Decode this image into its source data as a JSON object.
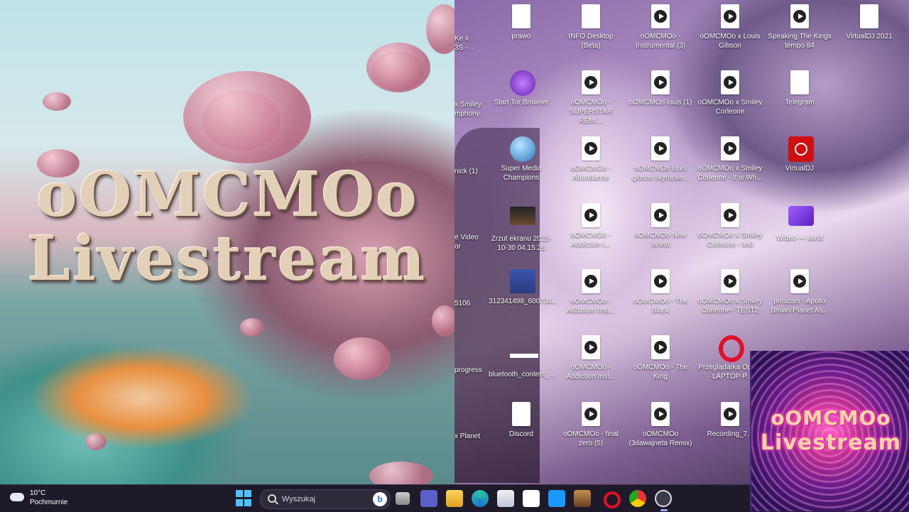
{
  "art_panel": {
    "title_line1": "oOMCMOo",
    "title_line2": "Livestream"
  },
  "desktop": {
    "cut_labels": [
      "Ke x\n3S -...",
      "x Smiley\nmphony",
      "nick (1)",
      "e Video\nor",
      "5106",
      "progress",
      "x Planet"
    ],
    "icons": [
      {
        "label": "prawo",
        "kind": "doc"
      },
      {
        "label": "INFO Desktop (Beta)",
        "kind": "doc"
      },
      {
        "label": "oOMCMOo - Instrumental (3)",
        "kind": "play"
      },
      {
        "label": "oOMCMOo x Louis Gibson",
        "kind": "play"
      },
      {
        "label": "Speaking The Kings tempo 84",
        "kind": "play"
      },
      {
        "label": "VirtualDJ 2021",
        "kind": "doc"
      },
      {
        "label": "Start Tor Browser",
        "kind": "tor"
      },
      {
        "label": "oOMCMOo - SUPERSTAR REMI...",
        "kind": "play"
      },
      {
        "label": "oOMCMOo louis (1)",
        "kind": "play"
      },
      {
        "label": "oOMCMOo x Smiley Corleone",
        "kind": "play"
      },
      {
        "label": "Telegram",
        "kind": "doc"
      },
      {
        "label": "Super Media Champions",
        "kind": "globe"
      },
      {
        "label": "oOMCMOo - Abundance",
        "kind": "play"
      },
      {
        "label": "oOMCMOo louis gibson skyrocke...",
        "kind": "play"
      },
      {
        "label": "oOMCMOo x Smiley Corleone - It is Wh...",
        "kind": "play"
      },
      {
        "label": "VirtualDJ",
        "kind": "vdj"
      },
      {
        "label": "Zrzut ekranu 2022-10-30 04.15.26",
        "kind": "image"
      },
      {
        "label": "oOMCMOo - Addiction I...",
        "kind": "play"
      },
      {
        "label": "oOMCMOo New World",
        "kind": "play"
      },
      {
        "label": "oOMCMOo x Smiley Corleone - test",
        "kind": "play"
      },
      {
        "label": "Wideo — skrót",
        "kind": "video"
      },
      {
        "label": "312341498_600734...",
        "kind": "image2"
      },
      {
        "label": "oOMCMOo - Addiction Inst...",
        "kind": "play"
      },
      {
        "label": "oOMCMOo - The Block",
        "kind": "play"
      },
      {
        "label": "oOMCMOo x Smiley Corleone - TEST2",
        "kind": "play"
      },
      {
        "label": "prilscom - Apollo Brown Planet As...",
        "kind": "play"
      },
      {
        "label": "bluetooth_content_...",
        "kind": "bar"
      },
      {
        "label": "oOMCMOo - Addiction Inst...",
        "kind": "play"
      },
      {
        "label": "oOMCMOo - The King",
        "kind": "play"
      },
      {
        "label": "Przeglądarka Opera - LAPTOP-P...",
        "kind": "opera"
      },
      {
        "label": "Discord",
        "kind": "doc"
      },
      {
        "label": "oOMCMOo - final zero (5)",
        "kind": "play"
      },
      {
        "label": "oOMCMOo (3dawajneta Remix)",
        "kind": "play"
      },
      {
        "label": "Recording_7...",
        "kind": "play"
      }
    ]
  },
  "overlay_logo": {
    "line1": "oOMCMOo",
    "line2": "Livestream"
  },
  "taskbar": {
    "temperature": "10°C",
    "condition": "Pochmurnie",
    "search_placeholder": "Wyszukaj",
    "bing_letter": "b",
    "apps": [
      "start",
      "search",
      "task-view",
      "teams",
      "file-explorer",
      "edge",
      "store",
      "amazon",
      "prime-video",
      "game",
      "opera",
      "chrome",
      "media-player"
    ]
  },
  "colors": {
    "taskbar_bg": "#1f1a2a",
    "accent": "#4cc2ff"
  }
}
